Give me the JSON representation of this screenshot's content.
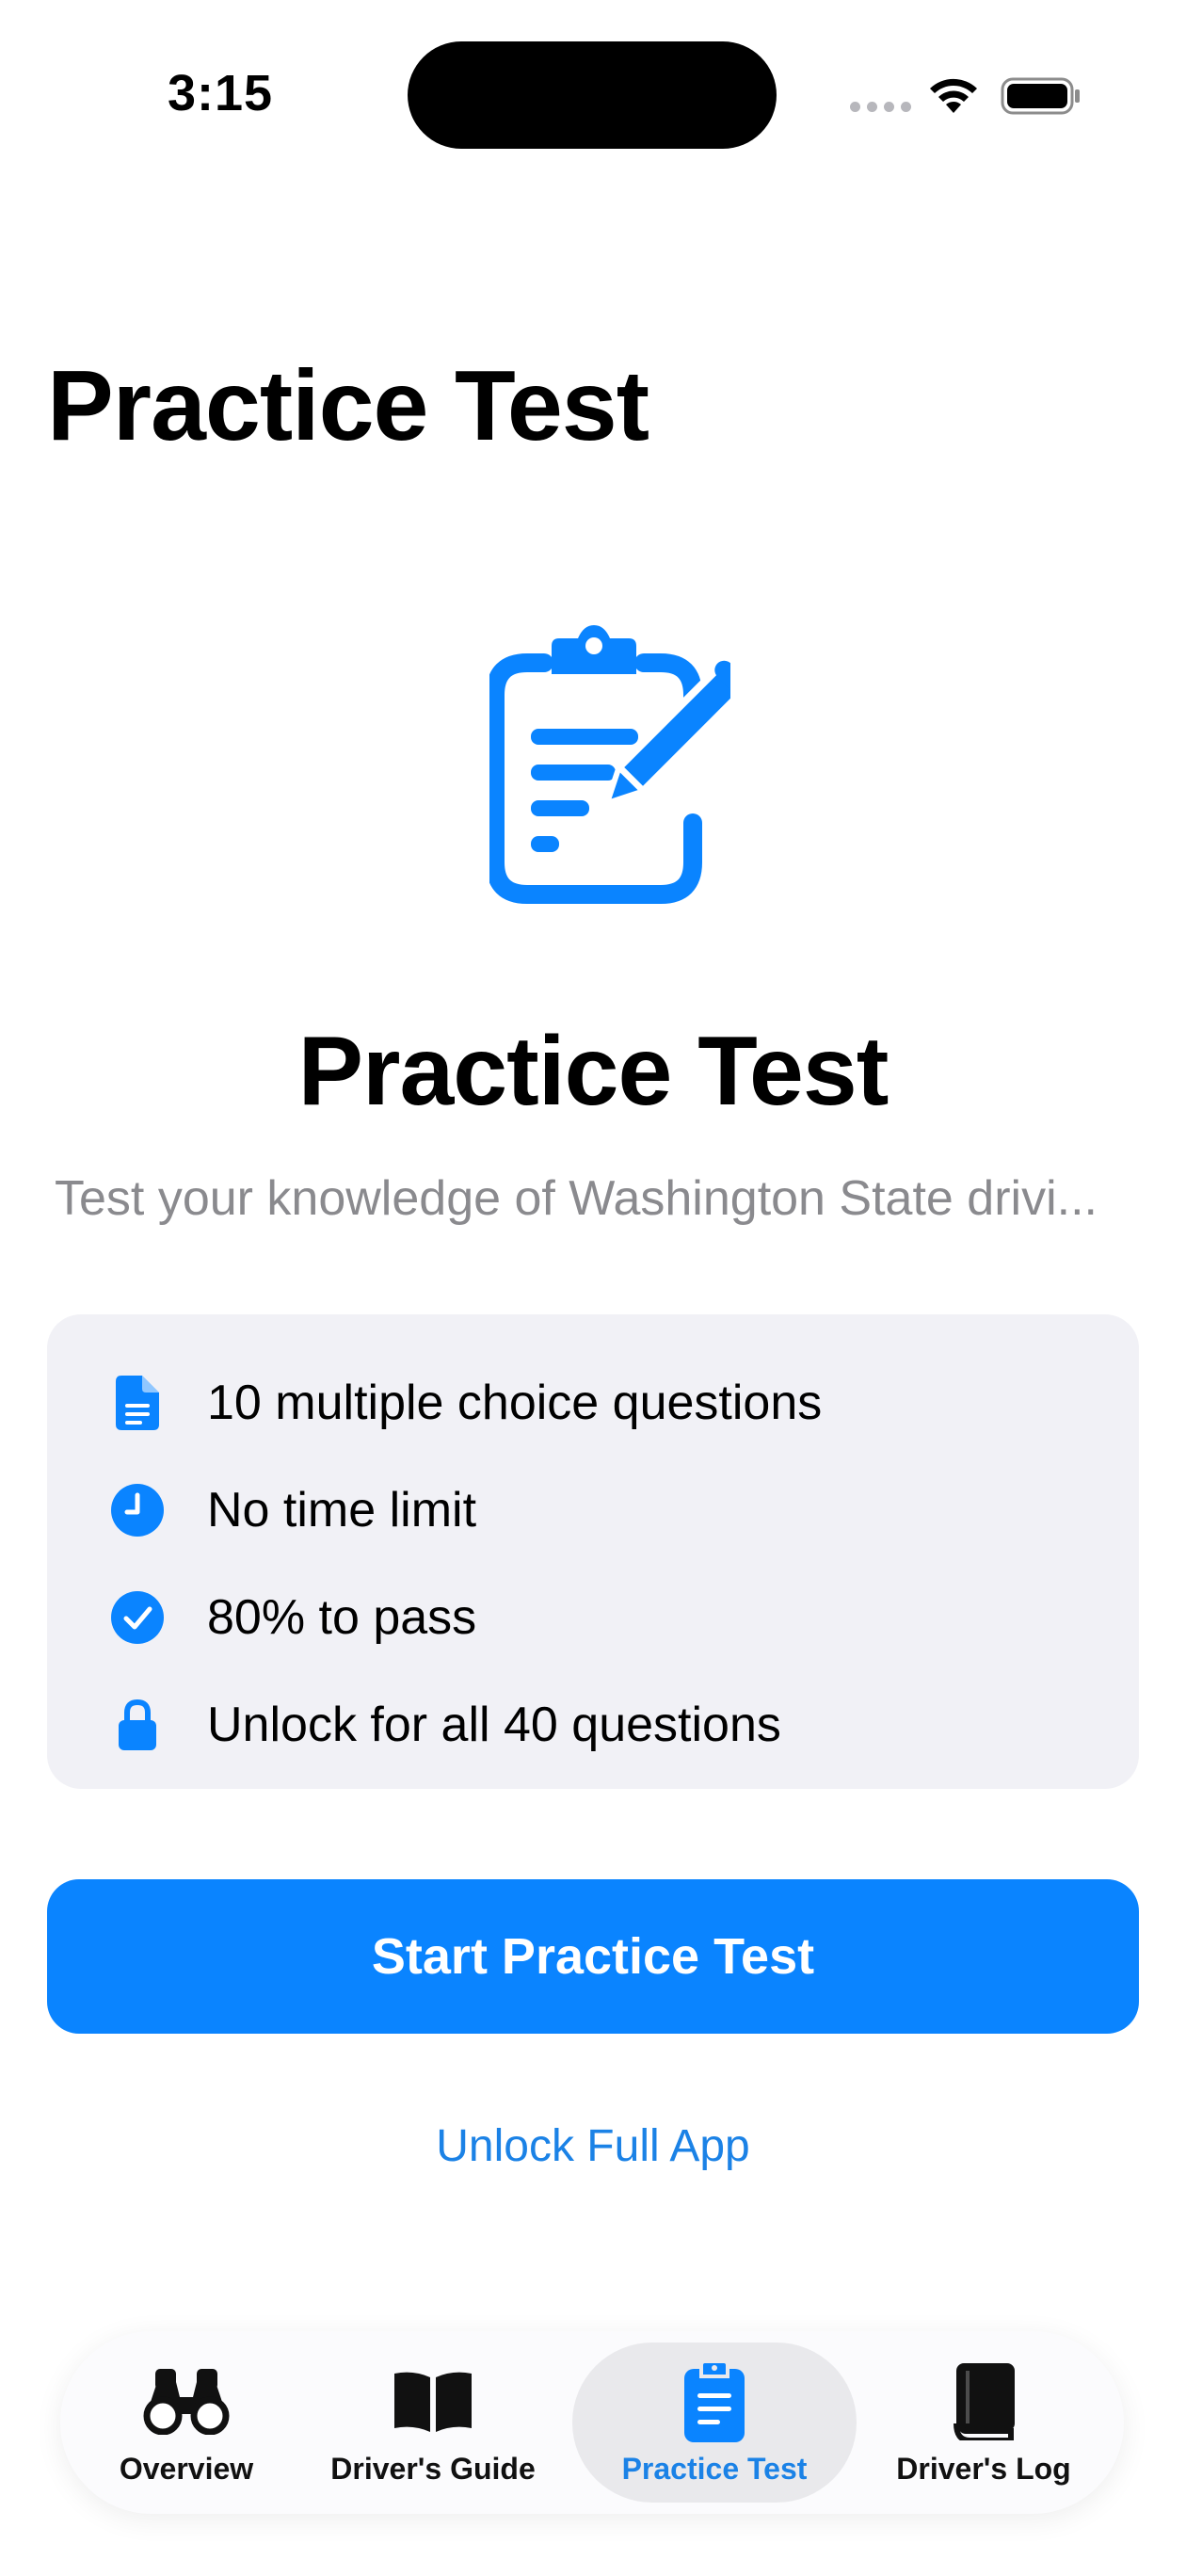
{
  "status_bar": {
    "time": "3:15"
  },
  "navigation": {
    "large_title": "Practice Test"
  },
  "hero": {
    "icon": "clipboard-pencil-icon",
    "title": "Practice Test",
    "subtitle": "Test your knowledge of Washington State drivi..."
  },
  "info": {
    "items": [
      {
        "icon": "document-icon",
        "text": "10 multiple choice questions"
      },
      {
        "icon": "clock-icon",
        "text": "No time limit"
      },
      {
        "icon": "checkmark-circle-icon",
        "text": "80% to pass"
      },
      {
        "icon": "lock-icon",
        "text": "Unlock for all 40 questions"
      }
    ]
  },
  "actions": {
    "primary": "Start Practice Test",
    "secondary": "Unlock Full App"
  },
  "tabbar": {
    "active_index": 2,
    "tabs": [
      {
        "label": "Overview",
        "icon": "binoculars-icon"
      },
      {
        "label": "Driver's Guide",
        "icon": "open-book-icon"
      },
      {
        "label": "Practice Test",
        "icon": "clipboard-icon"
      },
      {
        "label": "Driver's Log",
        "icon": "book-icon"
      }
    ]
  },
  "colors": {
    "accent": "#0a84ff",
    "link": "#1b82e6",
    "card_background": "#f1f1f6",
    "subtitle": "#8a8a8e"
  }
}
